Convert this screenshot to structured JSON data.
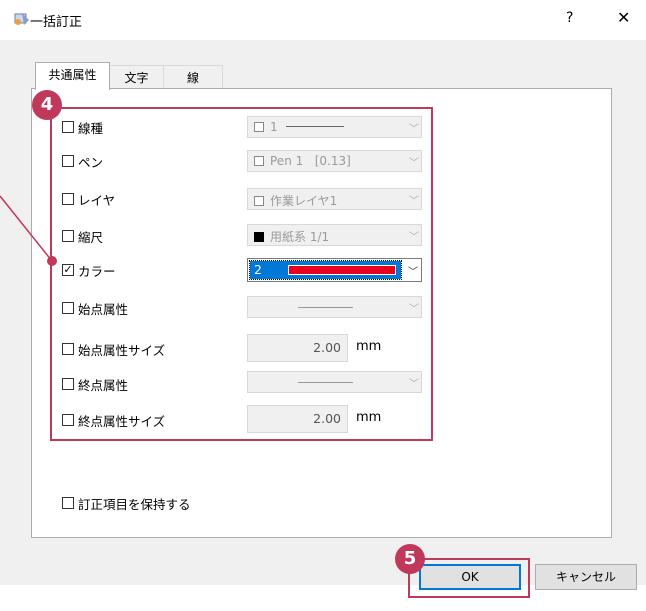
{
  "window": {
    "title": "一括訂正",
    "help_label": "?",
    "close_label": "✕"
  },
  "tabs": [
    "共通属性",
    "文字",
    "線"
  ],
  "rows": {
    "line_type": {
      "label": "線種",
      "value": "1",
      "checked": false
    },
    "pen": {
      "label": "ペン",
      "value": "Pen 1   [0.13]",
      "checked": false
    },
    "layer": {
      "label": "レイヤ",
      "value": "作業レイヤ1",
      "checked": false
    },
    "scale": {
      "label": "縮尺",
      "value": "用紙系 1/1",
      "checked": false
    },
    "color": {
      "label": "カラー",
      "value": "2",
      "checked": true,
      "swatch": "#e8001c"
    },
    "start_attr": {
      "label": "始点属性",
      "checked": false
    },
    "start_size": {
      "label": "始点属性サイズ",
      "value": "2.00",
      "unit": "mm",
      "checked": false
    },
    "end_attr": {
      "label": "終点属性",
      "checked": false
    },
    "end_size": {
      "label": "終点属性サイズ",
      "value": "2.00",
      "unit": "mm",
      "checked": false
    }
  },
  "keep_items": {
    "label": "訂正項目を保持する",
    "checked": false
  },
  "buttons": {
    "ok": "OK",
    "cancel": "キャンセル"
  },
  "annotations": {
    "step4": "4",
    "step5": "5",
    "accent": "#c0395a"
  }
}
